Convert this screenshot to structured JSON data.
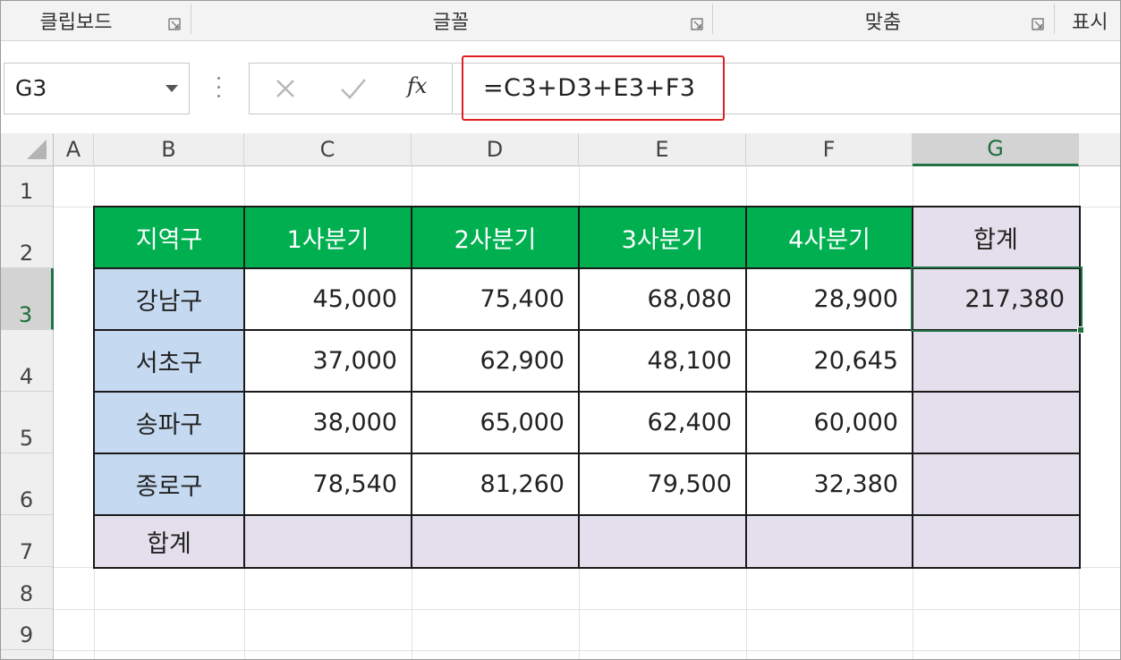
{
  "ribbon": {
    "groups": [
      {
        "label": "클립보드"
      },
      {
        "label": "글꼴"
      },
      {
        "label": "맞춤"
      },
      {
        "label": "표시"
      }
    ]
  },
  "formula_bar": {
    "name_box": "G3",
    "formula": "=C3+D3+E3+F3",
    "function_icon_label": "fx"
  },
  "columns": [
    "A",
    "B",
    "C",
    "D",
    "E",
    "F",
    "G"
  ],
  "selected_column": "G",
  "rows": [
    "1",
    "2",
    "3",
    "4",
    "5",
    "6",
    "7",
    "8",
    "9"
  ],
  "selected_row": "3",
  "table": {
    "headers": [
      "지역구",
      "1사분기",
      "2사분기",
      "3사분기",
      "4사분기",
      "합계"
    ],
    "rows": [
      {
        "district": "강남구",
        "q1": "45,000",
        "q2": "75,400",
        "q3": "68,080",
        "q4": "28,900",
        "total": "217,380"
      },
      {
        "district": "서초구",
        "q1": "37,000",
        "q2": "62,900",
        "q3": "48,100",
        "q4": "20,645",
        "total": ""
      },
      {
        "district": "송파구",
        "q1": "38,000",
        "q2": "65,000",
        "q3": "62,400",
        "q4": "60,000",
        "total": ""
      },
      {
        "district": "종로구",
        "q1": "78,540",
        "q2": "81,260",
        "q3": "79,500",
        "q4": "32,380",
        "total": ""
      }
    ],
    "total_row_label": "합계"
  },
  "colors": {
    "header_green": "#00b050",
    "district_blue": "#c5d9f1",
    "total_lavender": "#e4dfec",
    "selection_green": "#217346",
    "highlight_red": "#e02020"
  }
}
